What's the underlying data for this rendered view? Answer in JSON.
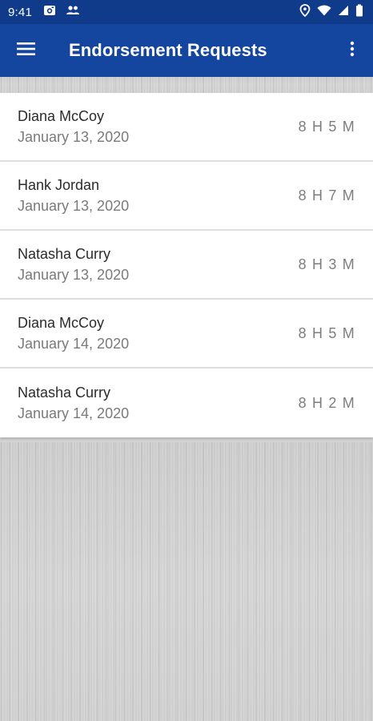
{
  "status_bar": {
    "time": "9:41",
    "left_icons": [
      "camera-icon",
      "people-icon"
    ],
    "right_icons": [
      "location-icon",
      "wifi-icon",
      "signal-icon",
      "battery-icon"
    ]
  },
  "app_bar": {
    "title": "Endorsement Requests",
    "menu_icon": "hamburger-menu-icon",
    "overflow_icon": "overflow-menu-icon"
  },
  "requests": [
    {
      "name": "Diana McCoy",
      "date": "January 13, 2020",
      "duration": "8 H 5 M"
    },
    {
      "name": "Hank Jordan",
      "date": "January 13, 2020",
      "duration": "8 H 7 M"
    },
    {
      "name": "Natasha Curry",
      "date": "January 13, 2020",
      "duration": "8 H 3 M"
    },
    {
      "name": "Diana McCoy",
      "date": "January 14, 2020",
      "duration": "8 H 5 M"
    },
    {
      "name": "Natasha Curry",
      "date": "January 14, 2020",
      "duration": "8 H 2 M"
    }
  ],
  "colors": {
    "status_bar": "#0f3b8a",
    "app_bar": "#1446a0",
    "list_background": "#ffffff",
    "brushed_background": "#d0d0d0"
  }
}
